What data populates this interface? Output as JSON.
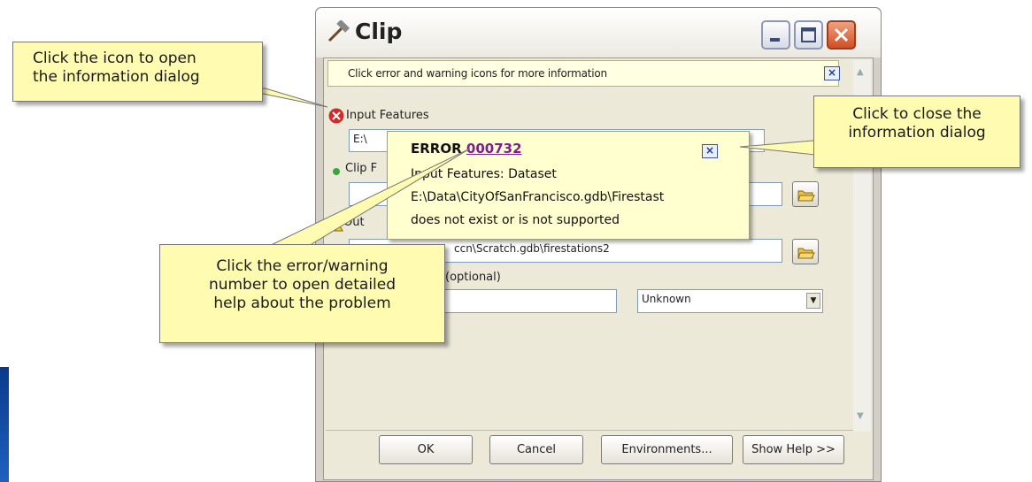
{
  "window": {
    "title": "Clip",
    "titlebar_icon": "hammer-icon",
    "buttons": [
      "minimize-icon",
      "maximize-icon",
      "close-icon"
    ]
  },
  "message_bar": {
    "text": "Click error and warning icons for more information"
  },
  "params": {
    "input_features": {
      "label": "Input Features",
      "value": "E:\\"
    },
    "clip_features": {
      "label": "Clip F"
    },
    "output": {
      "label": "Out",
      "value": "ccn\\Scratch.gdb\\firestations2"
    },
    "xy_tolerance": {
      "label": "(optional)",
      "unit": "Unknown"
    }
  },
  "footer": {
    "ok": "OK",
    "cancel": "Cancel",
    "environments": "Environments...",
    "help": "Show Help >>"
  },
  "popup": {
    "label": "ERROR",
    "code": "000732",
    "lines": [
      "Input Features: Dataset",
      "E:\\Data\\CityOfSanFrancisco.gdb\\Firestast",
      "does not exist or is not supported"
    ]
  },
  "callouts": {
    "icon": [
      "Click the icon to open",
      "the information dialog"
    ],
    "close": [
      "Click to close the",
      "information dialog"
    ],
    "number": [
      "Click the error/warning",
      "number to open detailed",
      "help about the problem"
    ]
  },
  "colors": {
    "callout": "#fffbb0",
    "tooltip": "#ffffcf",
    "error_link": "#7a2090",
    "error_red": "#d22b2b"
  }
}
